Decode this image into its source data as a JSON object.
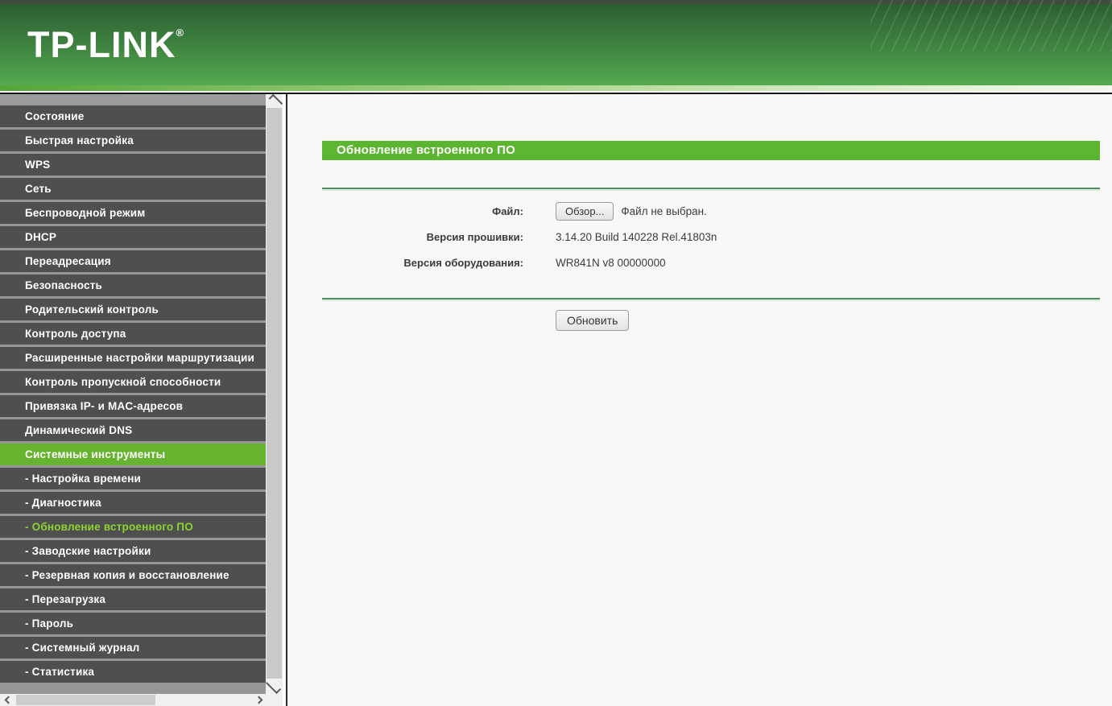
{
  "header": {
    "logo_text": "TP-LINK",
    "registered_mark": "®"
  },
  "sidebar": {
    "items": [
      {
        "id": "status",
        "label": "Состояние",
        "sub": false,
        "active": false
      },
      {
        "id": "quick-setup",
        "label": "Быстрая настройка",
        "sub": false,
        "active": false
      },
      {
        "id": "wps",
        "label": "WPS",
        "sub": false,
        "active": false
      },
      {
        "id": "network",
        "label": "Сеть",
        "sub": false,
        "active": false
      },
      {
        "id": "wireless",
        "label": "Беспроводной режим",
        "sub": false,
        "active": false
      },
      {
        "id": "dhcp",
        "label": "DHCP",
        "sub": false,
        "active": false
      },
      {
        "id": "forwarding",
        "label": "Переадресация",
        "sub": false,
        "active": false
      },
      {
        "id": "security",
        "label": "Безопасность",
        "sub": false,
        "active": false
      },
      {
        "id": "parental-control",
        "label": "Родительский контроль",
        "sub": false,
        "active": false
      },
      {
        "id": "access-control",
        "label": "Контроль доступа",
        "sub": false,
        "active": false
      },
      {
        "id": "advanced-routing",
        "label": "Расширенные настройки маршрутизации",
        "sub": false,
        "active": false
      },
      {
        "id": "bandwidth-control",
        "label": "Контроль пропускной способности",
        "sub": false,
        "active": false
      },
      {
        "id": "ip-mac-binding",
        "label": "Привязка IP- и MAC-адресов",
        "sub": false,
        "active": false
      },
      {
        "id": "dynamic-dns",
        "label": "Динамический DNS",
        "sub": false,
        "active": false
      },
      {
        "id": "system-tools",
        "label": "Системные инструменты",
        "sub": false,
        "active": true
      },
      {
        "id": "time-settings",
        "label": "- Настройка времени",
        "sub": true,
        "active": false
      },
      {
        "id": "diagnostic",
        "label": "- Диагностика",
        "sub": true,
        "active": false
      },
      {
        "id": "firmware-upgrade",
        "label": "- Обновление встроенного ПО",
        "sub": true,
        "active": true
      },
      {
        "id": "factory-defaults",
        "label": "- Заводские настройки",
        "sub": true,
        "active": false
      },
      {
        "id": "backup-restore",
        "label": "- Резервная копия и восстановление",
        "sub": true,
        "active": false
      },
      {
        "id": "reboot",
        "label": "- Перезагрузка",
        "sub": true,
        "active": false
      },
      {
        "id": "password",
        "label": "- Пароль",
        "sub": true,
        "active": false
      },
      {
        "id": "system-log",
        "label": "- Системный журнал",
        "sub": true,
        "active": false
      },
      {
        "id": "statistics",
        "label": "- Статистика",
        "sub": true,
        "active": false
      }
    ]
  },
  "main": {
    "title": "Обновление встроенного ПО",
    "form": {
      "file_label": "Файл:",
      "browse_button": "Обзор...",
      "file_status": "Файл не выбран.",
      "firmware_label": "Версия прошивки:",
      "firmware_value": "3.14.20 Build 140228 Rel.41803n",
      "hardware_label": "Версия оборудования:",
      "hardware_value": "WR841N v8 00000000",
      "submit_label": "Обновить"
    }
  },
  "colors": {
    "accent_green": "#5cb52f",
    "sidebar_active_bg": "#66b32f",
    "submenu_active_text": "#8cd42f",
    "sidebar_item_bg": "#4f4f4f",
    "header_gradient_top": "#2b5f31",
    "header_gradient_bottom": "#55a94f"
  }
}
